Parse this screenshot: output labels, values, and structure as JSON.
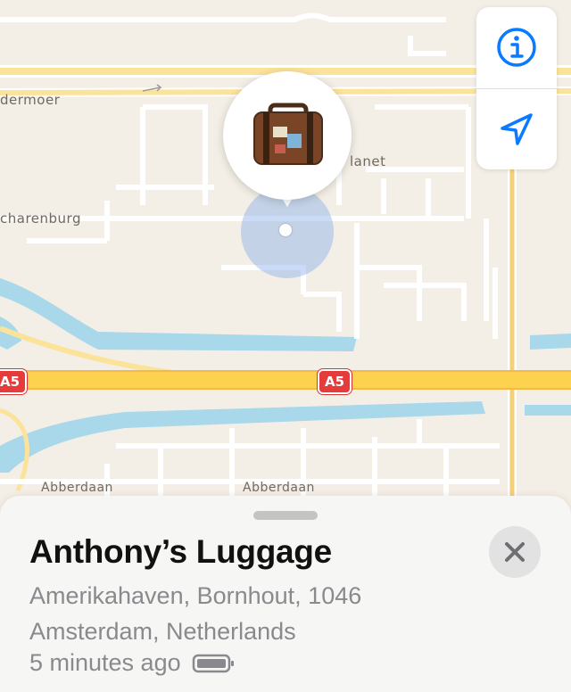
{
  "map": {
    "street_labels": {
      "dermoer": "dermoer",
      "planet": "lanet",
      "scharenburg": "charenburg",
      "abberdaan_left": "Abberdaan",
      "abberdaan_right": "Abberdaan"
    },
    "road_shields": {
      "a5_left": "A5",
      "a5_center": "A5"
    },
    "colors": {
      "land": "#f4efe6",
      "water": "#a8d8ea",
      "highway": "#fcd24f",
      "road": "#ffffff",
      "accent": "#0a7aff",
      "accuracy": "#7faaea"
    },
    "pin_icon": "luggage-icon"
  },
  "controls": {
    "info_icon": "info-icon",
    "location_icon": "location-arrow-icon"
  },
  "sheet": {
    "title": "Anthony’s Luggage",
    "address_line1": "Amerikahaven, Bornhout, 1046",
    "address_line2": "Amsterdam, Netherlands",
    "last_seen": "5 minutes ago",
    "battery_icon": "battery-icon",
    "close_icon": "close-icon"
  }
}
